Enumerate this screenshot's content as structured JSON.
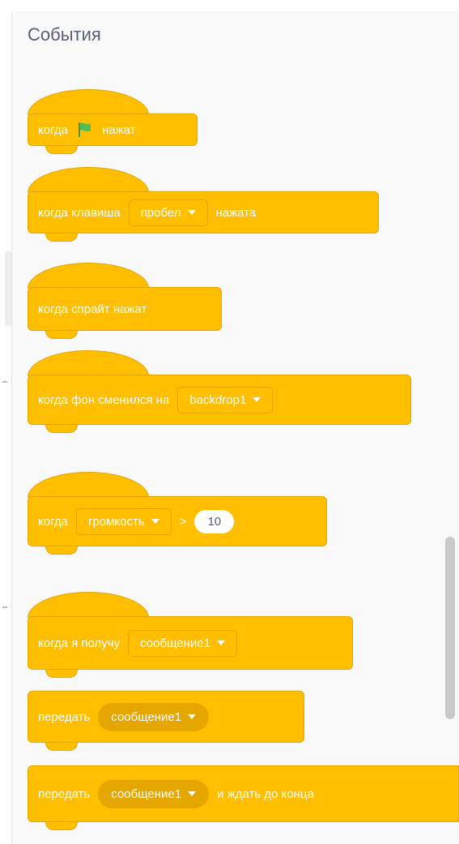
{
  "category": {
    "title": "События"
  },
  "colors": {
    "block": "#ffbf00",
    "block_border": "#e6a600",
    "text": "#ffffff"
  },
  "blocks": {
    "flag_clicked": {
      "prefix": "когда",
      "suffix": "нажат",
      "icon": "green-flag-icon"
    },
    "key_pressed": {
      "prefix": "когда клавиша",
      "key": "пробел",
      "suffix": "нажата"
    },
    "sprite_clicked": {
      "label": "когда спрайт нажат"
    },
    "backdrop_switch": {
      "prefix": "когда фон сменился на",
      "backdrop": "backdrop1"
    },
    "greater_than": {
      "prefix": "когда",
      "sensor": "громкость",
      "operator": ">",
      "value": "10"
    },
    "receive": {
      "prefix": "когда я получу",
      "message": "сообщение1"
    },
    "broadcast": {
      "prefix": "передать",
      "message": "сообщение1"
    },
    "broadcast_wait": {
      "prefix": "передать",
      "message": "сообщение1",
      "suffix": "и ждать до конца"
    }
  }
}
